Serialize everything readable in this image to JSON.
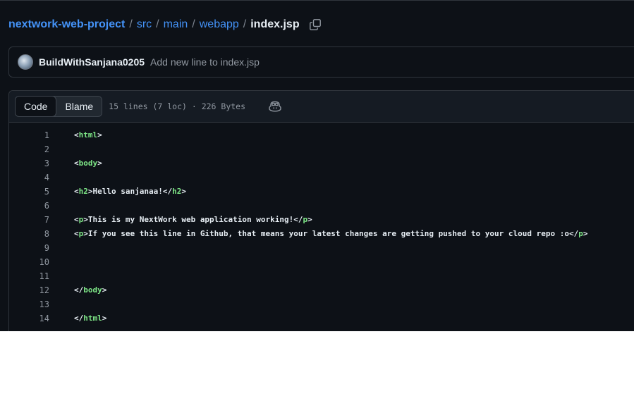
{
  "breadcrumb": {
    "repo": "nextwork-web-project",
    "separator": "/",
    "segments": [
      "src",
      "main",
      "webapp"
    ],
    "file": "index.jsp"
  },
  "commit": {
    "author": "BuildWithSanjana0205",
    "message": "Add new line to index.jsp"
  },
  "file_header": {
    "tabs": [
      {
        "label": "Code",
        "active": true
      },
      {
        "label": "Blame",
        "active": false
      }
    ],
    "meta": "15 lines (7 loc) · 226 Bytes"
  },
  "icons": {
    "copy_path": "copy-icon",
    "avatar": "user-avatar",
    "copilot": "copilot-icon"
  },
  "colors": {
    "background": "#0d1117",
    "link": "#4493f8",
    "tag": "#7ee787",
    "muted": "#9198a1",
    "border": "#30363d"
  },
  "code_lines": [
    {
      "number": "1",
      "parts": [
        [
          "p",
          "<"
        ],
        [
          "t",
          "html"
        ],
        [
          "p",
          ">"
        ]
      ]
    },
    {
      "number": "2",
      "parts": []
    },
    {
      "number": "3",
      "parts": [
        [
          "p",
          "<"
        ],
        [
          "t",
          "body"
        ],
        [
          "p",
          ">"
        ]
      ]
    },
    {
      "number": "4",
      "parts": []
    },
    {
      "number": "5",
      "parts": [
        [
          "p",
          "<"
        ],
        [
          "t",
          "h2"
        ],
        [
          "p",
          ">Hello sanjanaa!</"
        ],
        [
          "t",
          "h2"
        ],
        [
          "p",
          ">"
        ]
      ]
    },
    {
      "number": "6",
      "parts": []
    },
    {
      "number": "7",
      "parts": [
        [
          "p",
          "<"
        ],
        [
          "t",
          "p"
        ],
        [
          "p",
          ">This is my NextWork web application working!</"
        ],
        [
          "t",
          "p"
        ],
        [
          "p",
          ">"
        ]
      ]
    },
    {
      "number": "8",
      "parts": [
        [
          "p",
          "<"
        ],
        [
          "t",
          "p"
        ],
        [
          "p",
          ">If you see this line in Github, that means your latest changes are getting pushed to your cloud repo :o</"
        ],
        [
          "t",
          "p"
        ],
        [
          "p",
          ">"
        ]
      ]
    },
    {
      "number": "9",
      "parts": []
    },
    {
      "number": "10",
      "parts": []
    },
    {
      "number": "11",
      "parts": []
    },
    {
      "number": "12",
      "parts": [
        [
          "p",
          "</"
        ],
        [
          "t",
          "body"
        ],
        [
          "p",
          ">"
        ]
      ]
    },
    {
      "number": "13",
      "parts": []
    },
    {
      "number": "14",
      "parts": [
        [
          "p",
          "</"
        ],
        [
          "t",
          "html"
        ],
        [
          "p",
          ">"
        ]
      ]
    }
  ]
}
